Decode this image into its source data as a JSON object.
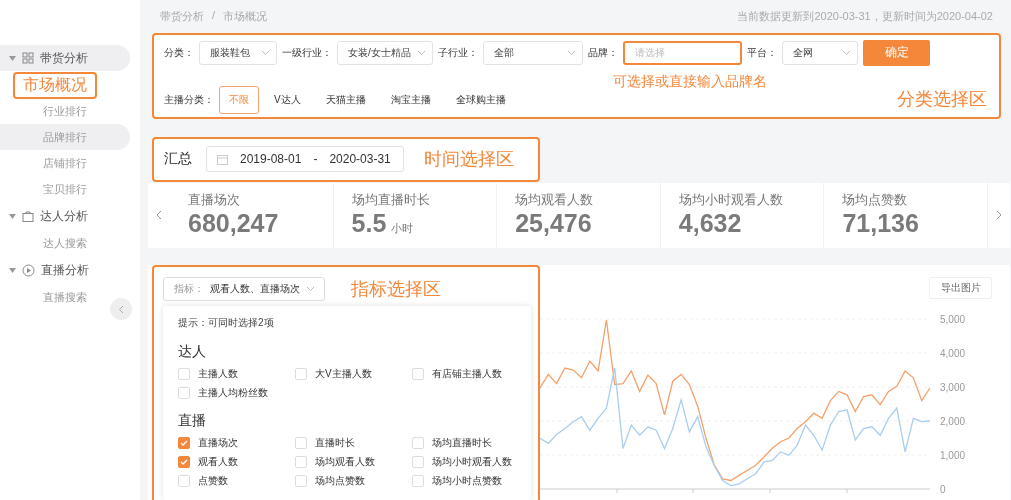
{
  "breadcrumb": {
    "items": [
      {
        "label": "带货分析"
      },
      {
        "label": "市场概况"
      }
    ],
    "separator": "/"
  },
  "update_notice": "当前数据更新到2020-03-31，更新时间为2020-04-02",
  "sidebar": {
    "groups": [
      {
        "label": "带货分析",
        "expanded": true,
        "highlighted": true,
        "children": [
          {
            "label": "市场概况",
            "selected": true,
            "highlighted": false
          },
          {
            "label": "行业排行",
            "selected": false,
            "highlighted": false
          },
          {
            "label": "品牌排行",
            "selected": false,
            "highlighted": true
          },
          {
            "label": "店铺排行",
            "selected": false,
            "highlighted": false
          },
          {
            "label": "宝贝排行",
            "selected": false,
            "highlighted": false
          }
        ]
      },
      {
        "label": "达人分析",
        "expanded": true,
        "highlighted": false,
        "children": [
          {
            "label": "达人搜索",
            "selected": false,
            "highlighted": false
          }
        ]
      },
      {
        "label": "直播分析",
        "expanded": true,
        "highlighted": false,
        "children": [
          {
            "label": "直播搜索",
            "selected": false,
            "highlighted": false
          }
        ]
      }
    ]
  },
  "filters": {
    "fields": [
      {
        "kind": "select",
        "label": "分类：",
        "value": "服装鞋包"
      },
      {
        "kind": "select",
        "label": "一级行业：",
        "value": "女装/女士精品"
      },
      {
        "kind": "select",
        "label": "子行业：",
        "value": "全部"
      },
      {
        "kind": "input",
        "label": "品牌：",
        "placeholder": "请选择"
      },
      {
        "kind": "select",
        "label": "平台：",
        "value": "全网"
      }
    ],
    "confirm_button": "确定",
    "anchor_label": "主播分类：",
    "anchor_types": [
      {
        "label": "不限",
        "selected": true
      },
      {
        "label": "V达人",
        "selected": false
      },
      {
        "label": "天猫主播",
        "selected": false
      },
      {
        "label": "淘宝主播",
        "selected": false
      },
      {
        "label": "全球购主播",
        "selected": false
      }
    ],
    "brand_hint": "可选择或直接输入品牌名",
    "annotation": "分类选择区"
  },
  "summary": {
    "title": "汇总",
    "start": "2019-08-01",
    "separator": "-",
    "end": "2020-03-31",
    "annotation": "时间选择区"
  },
  "stats": [
    {
      "label": "直播场次",
      "value": "680,247"
    },
    {
      "label": "场均直播时长",
      "value": "5.5",
      "unit": "小时"
    },
    {
      "label": "场均观看人数",
      "value": "25,476"
    },
    {
      "label": "场均小时观看人数",
      "value": "4,632"
    },
    {
      "label": "场均点赞数",
      "value": "71,136"
    }
  ],
  "indicator": {
    "select_label": "指标：",
    "select_value": "观看人数、直播场次",
    "annotation": "指标选择区",
    "tip": "提示：可同时选择2项",
    "groups": [
      {
        "title": "达人",
        "options": [
          {
            "label": "主播人数",
            "checked": false
          },
          {
            "label": "大V主播人数",
            "checked": false
          },
          {
            "label": "有店铺主播人数",
            "checked": false
          },
          {
            "label": "主播人均粉丝数",
            "checked": false
          }
        ]
      },
      {
        "title": "直播",
        "options": [
          {
            "label": "直播场次",
            "checked": true
          },
          {
            "label": "直播时长",
            "checked": false
          },
          {
            "label": "场均直播时长",
            "checked": false
          },
          {
            "label": "观看人数",
            "checked": true
          },
          {
            "label": "场均观看人数",
            "checked": false
          },
          {
            "label": "场均小时观看人数",
            "checked": false
          },
          {
            "label": "点赞数",
            "checked": false
          },
          {
            "label": "场均点赞数",
            "checked": false
          },
          {
            "label": "场均小时点赞数",
            "checked": false
          }
        ]
      }
    ]
  },
  "export_button": "导出图片",
  "chart_data": {
    "type": "line",
    "grid": true,
    "ylim": [
      0,
      5000
    ],
    "yticks": [
      {
        "value": 0,
        "label": "0"
      },
      {
        "value": 1000,
        "label": "1,000"
      },
      {
        "value": 2000,
        "label": "2,000"
      },
      {
        "value": 3000,
        "label": "3,000"
      },
      {
        "value": 4000,
        "label": "4,000"
      },
      {
        "value": 5000,
        "label": "5,000"
      }
    ],
    "series": [
      {
        "color": "#f5a06a",
        "values": [
          2970,
          3370,
          3100,
          3560,
          3500,
          3270,
          3760,
          3470,
          4970,
          3070,
          3100,
          3470,
          2870,
          3350,
          3100,
          2180,
          3170,
          3370,
          3070,
          2430,
          1490,
          700,
          300,
          250,
          400,
          550,
          700,
          940,
          1200,
          1390,
          1500,
          1780,
          1980,
          2230,
          2080,
          2600,
          2870,
          2770,
          2280,
          2720,
          2770,
          2480,
          2870,
          3020,
          3470,
          3270,
          2600,
          2970
        ]
      },
      {
        "color": "#a9cdf0",
        "values": [
          1490,
          1340,
          1600,
          1780,
          1980,
          2130,
          1730,
          2080,
          2380,
          3560,
          1190,
          1880,
          1580,
          1830,
          1730,
          1190,
          1780,
          2620,
          1680,
          2130,
          1240,
          690,
          250,
          100,
          150,
          300,
          450,
          790,
          840,
          1090,
          990,
          1290,
          1880,
          1580,
          1140,
          1880,
          2280,
          2330,
          1440,
          1780,
          1830,
          1580,
          2080,
          2380,
          1090,
          2080,
          1980,
          2000
        ]
      }
    ]
  }
}
